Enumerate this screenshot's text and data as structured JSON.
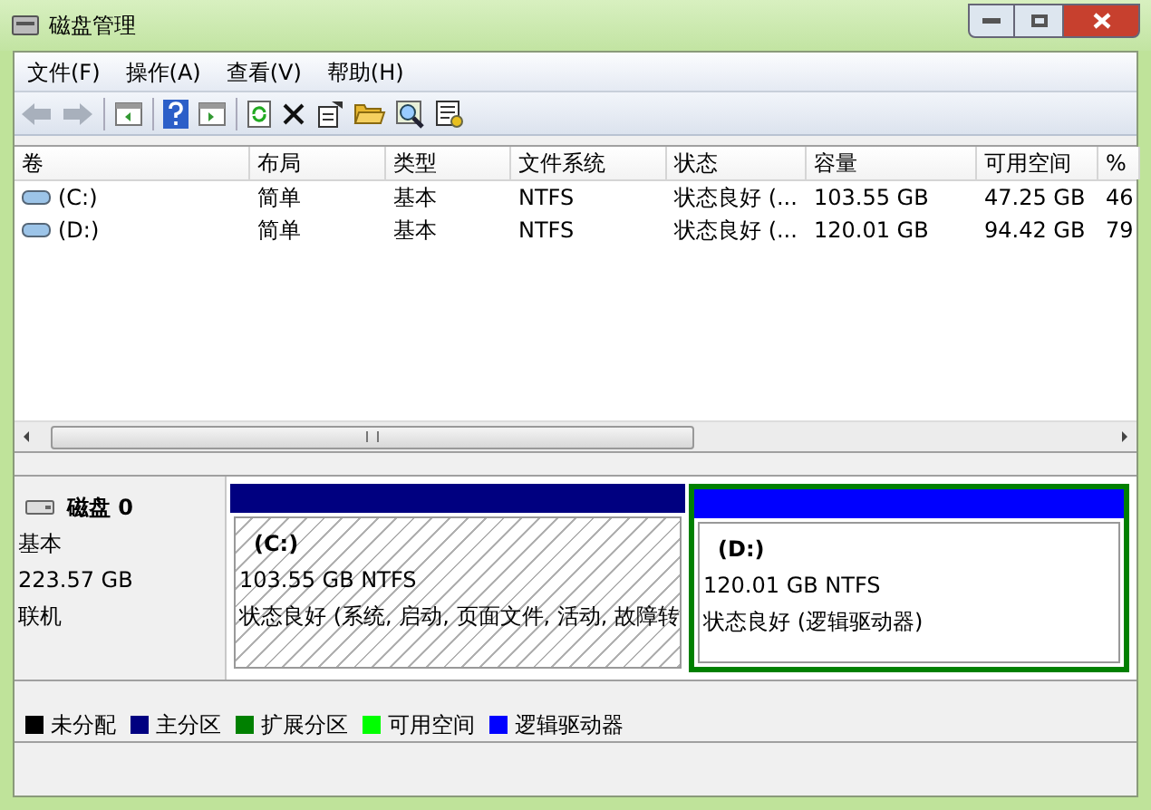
{
  "window": {
    "title": "磁盘管理"
  },
  "menu": [
    "文件(F)",
    "操作(A)",
    "查看(V)",
    "帮助(H)"
  ],
  "table": {
    "columns": [
      "卷",
      "布局",
      "类型",
      "文件系统",
      "状态",
      "容量",
      "可用空间",
      "%"
    ],
    "rows": [
      [
        "(C:)",
        "简单",
        "基本",
        "NTFS",
        "状态良好 (...",
        "103.55 GB",
        "47.25 GB",
        "46"
      ],
      [
        "(D:)",
        "简单",
        "基本",
        "NTFS",
        "状态良好 (...",
        "120.01 GB",
        "94.42 GB",
        "79"
      ]
    ]
  },
  "disk": {
    "name": "磁盘 0",
    "type": "基本",
    "size": "223.57 GB",
    "state": "联机",
    "partitions": [
      {
        "kind": "primary",
        "label": "(C:)",
        "size": "103.55 GB NTFS",
        "status": "状态良好 (系统, 启动, 页面文件, 活动, 故障转",
        "selected": true
      },
      {
        "kind": "logical",
        "label": "(D:)",
        "size": "120.01 GB NTFS",
        "status": "状态良好 (逻辑驱动器)",
        "selected": false
      }
    ]
  },
  "legend": [
    {
      "label": "未分配",
      "color": "#000000"
    },
    {
      "label": "主分区",
      "color": "#000080"
    },
    {
      "label": "扩展分区",
      "color": "#008000"
    },
    {
      "label": "可用空间",
      "color": "#00ff00"
    },
    {
      "label": "逻辑驱动器",
      "color": "#0000ff"
    }
  ]
}
